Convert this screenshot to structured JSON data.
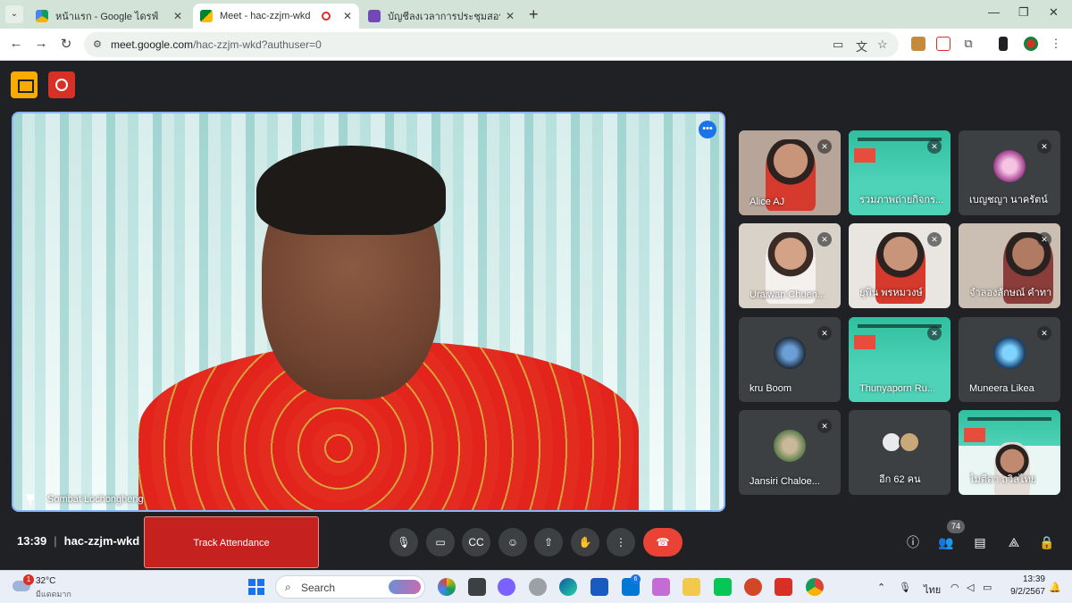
{
  "browser": {
    "tabs": [
      {
        "title": "หน้าแรก - Google ไดรฟ์",
        "active": false
      },
      {
        "title": "Meet - hac-zzjm-wkd",
        "active": true
      },
      {
        "title": "บัญชีลงเวลาการประชุมสอบ CEFR ปี",
        "active": false
      }
    ],
    "url_host": "meet.google.com",
    "url_path": "/hac-zzjm-wkd?authuser=0"
  },
  "meet": {
    "main_speaker": "Sombat Lochongheng",
    "meeting_code": "hac-zzjm-wkd",
    "clock": "13:39",
    "track_attendance_label": "Track Attendance",
    "participant_count": "74",
    "tiles": [
      {
        "name": "Alice AJ"
      },
      {
        "name": "รวมภาพถ่ายกิจกร..."
      },
      {
        "name": "เบญชญา นาครัตน์"
      },
      {
        "name": "Uraiwan Chuen..."
      },
      {
        "name": "ยุพิน พรหมวงษ์"
      },
      {
        "name": "จำลองลักษณ์ คำทา"
      },
      {
        "name": "kru Boom"
      },
      {
        "name": "Thunyaporn Ru..."
      },
      {
        "name": "Muneera Likea"
      },
      {
        "name": "Jansiri Chaloe..."
      },
      {
        "name": "อีก 62 คน"
      },
      {
        "name": "ไมตีดา ถวิลไทย"
      }
    ],
    "accent_end_call": "#ea4335"
  },
  "taskbar": {
    "weather_temp": "32°C",
    "weather_cond": "มีแดดมาก",
    "weather_badge": "1",
    "search_label": "Search",
    "outlook_badge": "6",
    "lang": "ไทย",
    "time": "13:39",
    "date": "9/2/2567"
  }
}
